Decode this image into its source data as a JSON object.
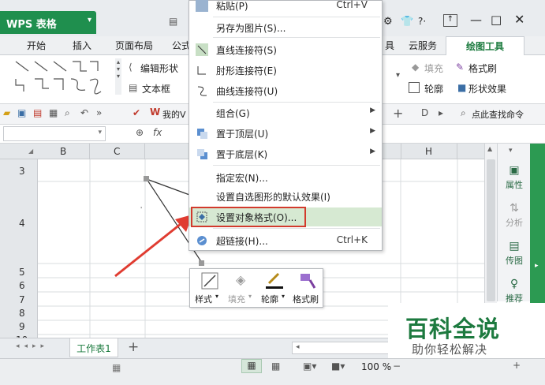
{
  "app": {
    "title": "WPS 表格"
  },
  "window_controls": {
    "help": "?·",
    "more": "|",
    "restore": "▭",
    "min": "—",
    "max": "□",
    "close": "✕"
  },
  "tabs": {
    "start": "开始",
    "insert": "插入",
    "layout": "页面布局",
    "formula": "公式",
    "cut": "具",
    "cloud": "云服务",
    "draw": "绘图工具"
  },
  "ribbon": {
    "edit_shape": "编辑形状",
    "textbox": "文本框",
    "fill": "填充",
    "format_brush": "格式刷",
    "outline": "轮廓",
    "shape_effect": "形状效果"
  },
  "qat": {
    "doc_tab": "我的V",
    "search": "点此查找命令"
  },
  "formula_bar": {
    "fx": "fx"
  },
  "columns": [
    "B",
    "C",
    "H"
  ],
  "rows": [
    "3",
    "4",
    "5",
    "6",
    "7",
    "8",
    "9",
    "10"
  ],
  "side_panel": {
    "props": "属性",
    "analysis": "分析",
    "pass_image": "传图",
    "recommend": "推荐"
  },
  "sheet": {
    "tab": "工作表1",
    "add": "+"
  },
  "status": {
    "zoom": "100 %"
  },
  "context_menu": {
    "paste": "粘贴(P)",
    "paste_sc": "Ctrl+V",
    "save_as_image": "另存为图片(S)...",
    "straight_connector": "直线连接符(S)",
    "elbow_connector": "肘形连接符(E)",
    "curve_connector": "曲线连接符(U)",
    "group": "组合(G)",
    "bring_top": "置于顶层(U)",
    "send_bottom": "置于底层(K)",
    "assign_macro": "指定宏(N)...",
    "set_default": "设置自选图形的默认效果(I)",
    "format_object": "设置对象格式(O)...",
    "hyperlink": "超链接(H)...",
    "hyperlink_sc": "Ctrl+K"
  },
  "mini_toolbar": {
    "style": "样式",
    "fill": "填充",
    "outline": "轮廓",
    "brush": "格式刷"
  },
  "watermark": {
    "title": "百科全说",
    "subtitle": "助你轻松解决"
  },
  "colors": {
    "accent": "#1f8f4e",
    "highlight_border": "#d23a2d",
    "arrow": "#e03c31"
  }
}
